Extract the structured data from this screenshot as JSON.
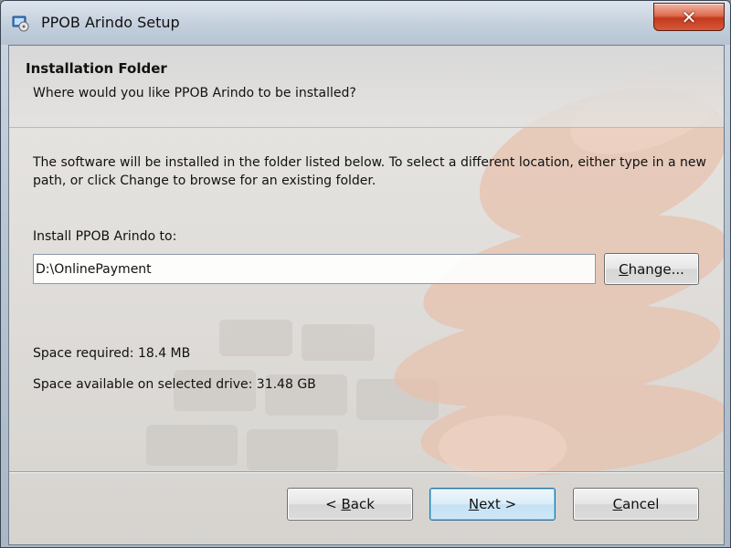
{
  "window": {
    "title": "PPOB Arindo Setup",
    "close_glyph": "✕"
  },
  "header": {
    "title": "Installation Folder",
    "subtitle": "Where would you like PPOB Arindo to be installed?"
  },
  "body": {
    "description": "The software will be installed in the folder listed below. To select a different location, either type in a new path, or click Change to browse for an existing folder.",
    "install_label": "Install PPOB Arindo to:",
    "path_value": "D:\\OnlinePayment",
    "change_button": {
      "mnemonic": "C",
      "rest": "hange..."
    },
    "space_required": "Space required: 18.4 MB",
    "space_available": "Space available on selected drive: 31.48 GB"
  },
  "footer": {
    "back_button": {
      "prefix": "< ",
      "mnemonic": "B",
      "rest": "ack"
    },
    "next_button": {
      "mnemonic": "N",
      "rest": "ext >"
    },
    "cancel_button": {
      "mnemonic": "C",
      "rest": "ancel"
    }
  },
  "icons": {
    "app": "setup-icon",
    "close": "close-icon"
  },
  "colors": {
    "close_button": "#c23a1d",
    "default_button_border": "#2f6c94",
    "title_bar": "#c3cfdc"
  }
}
